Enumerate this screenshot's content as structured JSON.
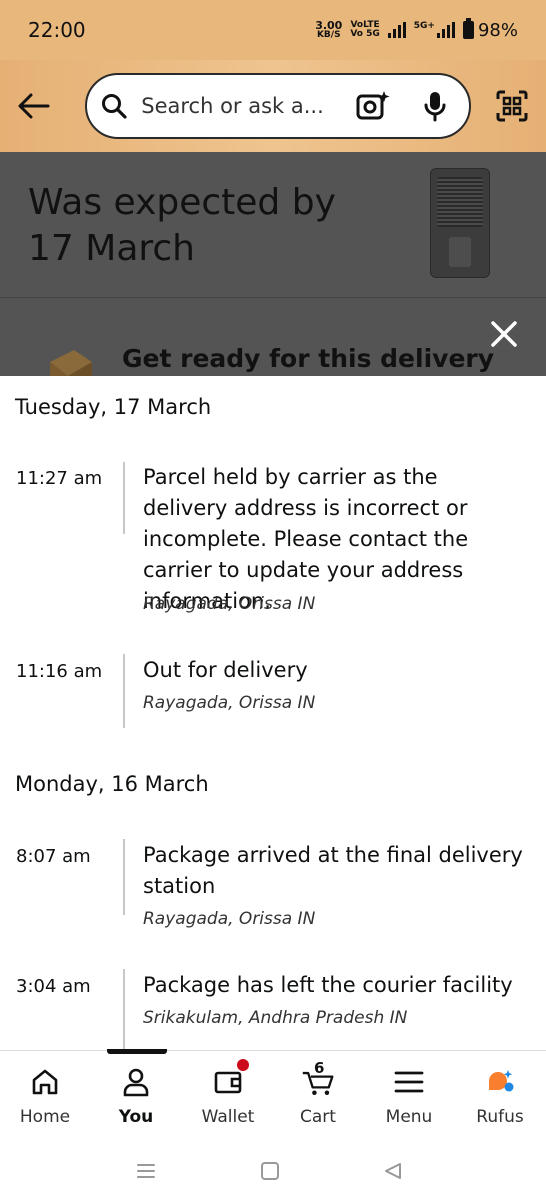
{
  "status_bar": {
    "time": "22:00",
    "net_speed_value": "3.00",
    "net_speed_unit": "KB/S",
    "network_tag_top": "VoLTE",
    "network_tag_bottom": "Vo 5G",
    "network_5g": "5G+",
    "battery": "98%"
  },
  "header": {
    "search_placeholder": "Search or ask a..."
  },
  "expected": {
    "line1": "Was expected by",
    "line2": "17 March"
  },
  "banner": {
    "ready_text": "Get ready for this delivery"
  },
  "tracking": [
    {
      "day": "Tuesday, 17 March",
      "events": [
        {
          "time": "11:27 am",
          "desc": "Parcel held by carrier as the delivery address is incorrect or incomplete. Please contact the carrier to update your address information.",
          "location": "Rayagada, Orissa IN"
        },
        {
          "time": "11:16 am",
          "desc": "Out for delivery",
          "location": "Rayagada, Orissa IN"
        }
      ]
    },
    {
      "day": "Monday, 16 March",
      "events": [
        {
          "time": "8:07 am",
          "desc": "Package arrived at the final delivery station",
          "location": "Rayagada, Orissa IN"
        },
        {
          "time": "3:04 am",
          "desc": "Package has left the courier facility",
          "location": "Srikakulam, Andhra Pradesh IN"
        }
      ]
    }
  ],
  "bottom_nav": {
    "items": [
      {
        "label": "Home",
        "icon": "home-icon"
      },
      {
        "label": "You",
        "icon": "person-icon",
        "active": true
      },
      {
        "label": "Wallet",
        "icon": "wallet-icon"
      },
      {
        "label": "Cart",
        "icon": "cart-icon",
        "count": "6"
      },
      {
        "label": "Menu",
        "icon": "menu-icon"
      },
      {
        "label": "Rufus",
        "icon": "rufus-icon"
      }
    ]
  },
  "colors": {
    "header_bg": "#e8b77c",
    "dim_overlay": "#545454",
    "accent_red": "#cc0c1c",
    "rufus_orange": "#f97f2e",
    "rufus_blue": "#1e88e5"
  }
}
